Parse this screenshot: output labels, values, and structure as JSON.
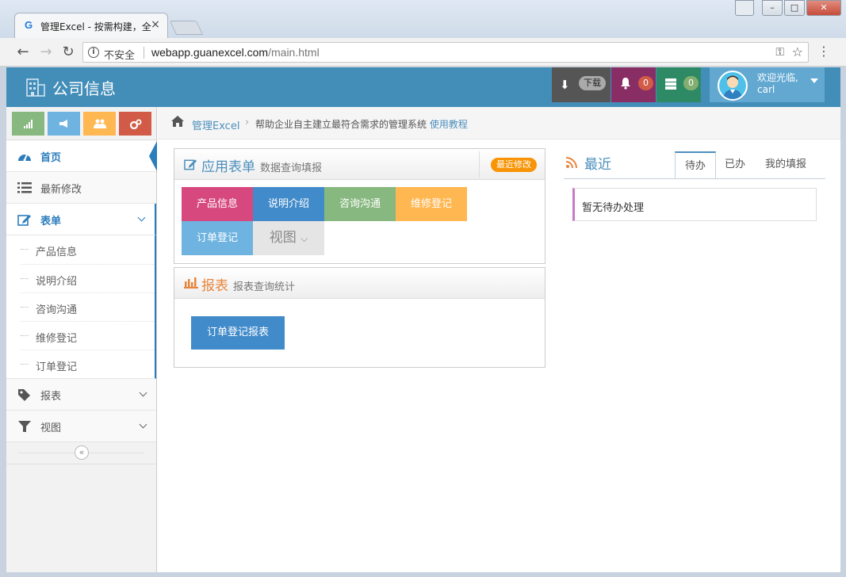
{
  "browser": {
    "tab_title": "管理Excel - 按需构建，全",
    "tab_favicon": "G",
    "tab_close": "×",
    "insecure_label": "不安全",
    "url_host": "webapp.guanexcel.com",
    "url_path": "/main.html"
  },
  "header": {
    "title": "公司信息",
    "download_label": "下载",
    "notifications_count": "0",
    "messages_count": "0",
    "welcome_line1": "欢迎光临,",
    "welcome_line2": "carl"
  },
  "sidebar": {
    "items": [
      {
        "label": "首页",
        "icon": "dashboard-icon"
      },
      {
        "label": "最新修改",
        "icon": "list-icon"
      },
      {
        "label": "表单",
        "icon": "edit-icon"
      },
      {
        "label": "报表",
        "icon": "tag-icon"
      },
      {
        "label": "视图",
        "icon": "filter-icon"
      }
    ],
    "form_subitems": [
      "产品信息",
      "说明介绍",
      "咨询沟通",
      "维修登记",
      "订单登记"
    ],
    "collapse_symbol": "«"
  },
  "breadcrumb": {
    "home": "管理Excel",
    "description": "帮助企业自主建立最符合需求的管理系统",
    "tutorial": "使用教程"
  },
  "forms_box": {
    "title": "应用表单",
    "subtitle": "数据查询填报",
    "badge": "最近修改",
    "tiles": [
      "产品信息",
      "说明介绍",
      "咨询沟通",
      "维修登记",
      "订单登记"
    ],
    "view_tile": "视图"
  },
  "reports_box": {
    "title": "报表",
    "subtitle": "报表查询统计",
    "button": "订单登记报表"
  },
  "recent": {
    "title": "最近",
    "tabs": [
      "待办",
      "已办",
      "我的填报"
    ],
    "empty_text": "暂无待办处理"
  },
  "colors": {
    "header": "#438eb9",
    "accent": "#2b7dbc",
    "tile_pink": "#d6487e",
    "tile_blue": "#428bca",
    "tile_green": "#87b87f",
    "tile_orange": "#ffb752",
    "tile_sky": "#6fb3e0"
  }
}
